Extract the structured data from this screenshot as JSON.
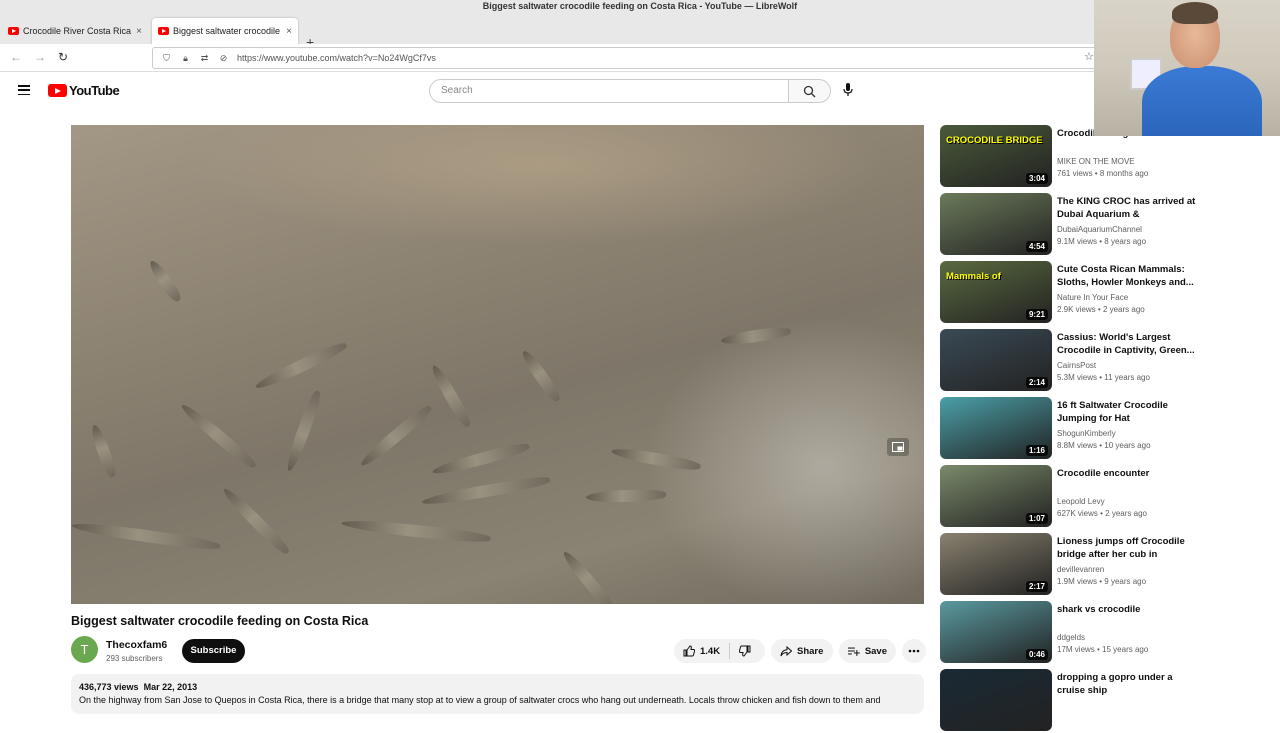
{
  "browser": {
    "window_title": "Biggest saltwater crocodile feeding on Costa Rica - YouTube — LibreWolf",
    "tabs": [
      {
        "label": "Crocodile River Costa Rica"
      },
      {
        "label": "Biggest saltwater crocodile feeding on Costa Rica"
      }
    ],
    "url": "https://www.youtube.com/watch?v=No24WgCf7vs"
  },
  "header": {
    "logo_text": "YouTube",
    "search_placeholder": "Search"
  },
  "video": {
    "title": "Biggest saltwater crocodile feeding on Costa Rica",
    "channel": {
      "avatar_letter": "T",
      "name": "Thecoxfam6",
      "subscribers": "293 subscribers"
    },
    "subscribe_label": "Subscribe",
    "likes": "1.4K",
    "share_label": "Share",
    "save_label": "Save",
    "description": {
      "views": "436,773 views",
      "date": "Mar 22, 2013",
      "text": "On the highway from San Jose to Quepos in Costa Rica, there is a bridge that many stop at to view a group of saltwater crocs who hang out underneath. Locals throw chicken and fish down to them and"
    }
  },
  "related": [
    {
      "title": "Crocodile Bridge Costa Rica",
      "channel": "MIKE ON THE MOVE",
      "views": "761 views",
      "age": "8 months ago",
      "duration": "3:04",
      "thumb_caption": "CROCODILE BRIDGE",
      "thumb_color": "#4a5a3a"
    },
    {
      "title": "The KING CROC has arrived at Dubai Aquarium & Underwater...",
      "channel": "DubaiAquariumChannel",
      "views": "9.1M views",
      "age": "8 years ago",
      "duration": "4:54",
      "thumb_caption": "",
      "thumb_color": "#6b7a5a"
    },
    {
      "title": "Cute Costa Rican Mammals: Sloths, Howler Monkeys and...",
      "channel": "Nature In Your Face",
      "views": "2.9K views",
      "age": "2 years ago",
      "duration": "9:21",
      "thumb_caption": "Mammals of",
      "thumb_color": "#5a6a40"
    },
    {
      "title": "Cassius: World's Largest Crocodile in Captivity, Green...",
      "channel": "CairnsPost",
      "views": "5.3M views",
      "age": "11 years ago",
      "duration": "2:14",
      "thumb_caption": "",
      "thumb_color": "#3a4a55"
    },
    {
      "title": "16 ft Saltwater Crocodile Jumping for Hat",
      "channel": "ShogunKimberly",
      "views": "8.8M views",
      "age": "10 years ago",
      "duration": "1:16",
      "thumb_caption": "",
      "thumb_color": "#4aa0a8"
    },
    {
      "title": "Crocodile encounter",
      "channel": "Leopold Levy",
      "views": "627K views",
      "age": "2 years ago",
      "duration": "1:07",
      "thumb_caption": "",
      "thumb_color": "#7a8a6a"
    },
    {
      "title": "Lioness jumps off Crocodile bridge after her cub in Kruger...",
      "channel": "devillevanren",
      "views": "1.9M views",
      "age": "9 years ago",
      "duration": "2:17",
      "thumb_caption": "",
      "thumb_color": "#8a8270"
    },
    {
      "title": "shark vs crocodile",
      "channel": "ddgelds",
      "views": "17M views",
      "age": "15 years ago",
      "duration": "0:46",
      "thumb_caption": "",
      "thumb_color": "#5a9aa0"
    },
    {
      "title": "dropping a gopro under a cruise ship",
      "channel": "",
      "views": "",
      "age": "",
      "duration": "",
      "thumb_caption": "",
      "thumb_color": "#1a2a35"
    }
  ]
}
